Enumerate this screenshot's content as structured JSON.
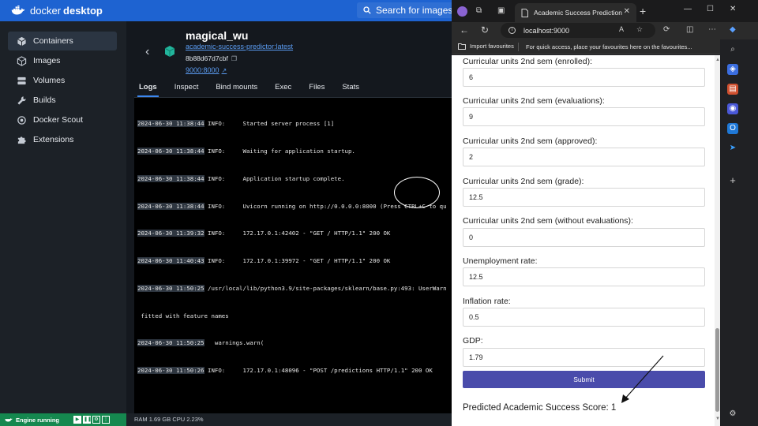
{
  "docker": {
    "brand_light": "docker",
    "brand_bold": "desktop",
    "search_text": "Search for images, cont",
    "sidebar": [
      {
        "label": "Containers",
        "icon": "cube-icon",
        "active": true
      },
      {
        "label": "Images",
        "icon": "images-icon",
        "active": false
      },
      {
        "label": "Volumes",
        "icon": "volumes-icon",
        "active": false
      },
      {
        "label": "Builds",
        "icon": "wrench-icon",
        "active": false
      },
      {
        "label": "Docker Scout",
        "icon": "scout-icon",
        "active": false
      },
      {
        "label": "Extensions",
        "icon": "puzzle-icon",
        "active": false
      }
    ],
    "container": {
      "name": "magical_wu",
      "image": "academic-success-predictor:latest",
      "id": "8b88d67d7cbf",
      "port": "9000:8000"
    },
    "tabs": [
      "Logs",
      "Inspect",
      "Bind mounts",
      "Exec",
      "Files",
      "Stats"
    ],
    "active_tab": "Logs",
    "logs": [
      {
        "ts": "2024-06-30 11:38:44",
        "text": " INFO:     Started server process [1]"
      },
      {
        "ts": "2024-06-30 11:38:44",
        "text": " INFO:     Waiting for application startup."
      },
      {
        "ts": "2024-06-30 11:38:44",
        "text": " INFO:     Application startup complete."
      },
      {
        "ts": "2024-06-30 11:38:44",
        "text": " INFO:     Uvicorn running on http://0.0.0.0:8000 (Press CTRL+C to qu"
      },
      {
        "ts": "2024-06-30 11:39:32",
        "text": " INFO:     172.17.0.1:42402 - \"GET / HTTP/1.1\" 200 OK"
      },
      {
        "ts": "2024-06-30 11:40:43",
        "text": " INFO:     172.17.0.1:39972 - \"GET / HTTP/1.1\" 200 OK"
      },
      {
        "ts": "2024-06-30 11:50:25",
        "text": " /usr/local/lib/python3.9/site-packages/sklearn/base.py:493: UserWarn"
      },
      {
        "ts": "",
        "text": " fitted with feature names"
      },
      {
        "ts": "2024-06-30 11:50:25",
        "text": "   warnings.warn("
      },
      {
        "ts": "2024-06-30 11:50:26",
        "text": " INFO:     172.17.0.1:48096 - \"POST /predictions HTTP/1.1\" 200 OK"
      }
    ],
    "status": {
      "engine": "Engine running",
      "ram_cpu": "RAM 1.69 GB  CPU 2.23%"
    },
    "colors": {
      "brand": "#1e63d1",
      "engine_green": "#15884f",
      "link": "#5b9cf2"
    }
  },
  "browser": {
    "tab_title": "Academic Success Prediction",
    "url": "localhost:9000",
    "favbar": {
      "import": "Import favourites",
      "quick_access": "For quick access, place your favourites here on the favourites..."
    },
    "form": {
      "fields": [
        {
          "label": "Curricular units 2nd sem (enrolled):",
          "value": "6"
        },
        {
          "label": "Curricular units 2nd sem (evaluations):",
          "value": "9"
        },
        {
          "label": "Curricular units 2nd sem (approved):",
          "value": "2"
        },
        {
          "label": "Curricular units 2nd sem (grade):",
          "value": "12.5"
        },
        {
          "label": "Curricular units 2nd sem (without evaluations):",
          "value": "0"
        },
        {
          "label": "Unemployment rate:",
          "value": "12.5"
        },
        {
          "label": "Inflation rate:",
          "value": "0.5"
        },
        {
          "label": "GDP:",
          "value": "1.79"
        }
      ],
      "submit": "Submit",
      "result": "Predicted Academic Success Score: 1"
    },
    "colors": {
      "submit": "#4a4cab"
    }
  }
}
